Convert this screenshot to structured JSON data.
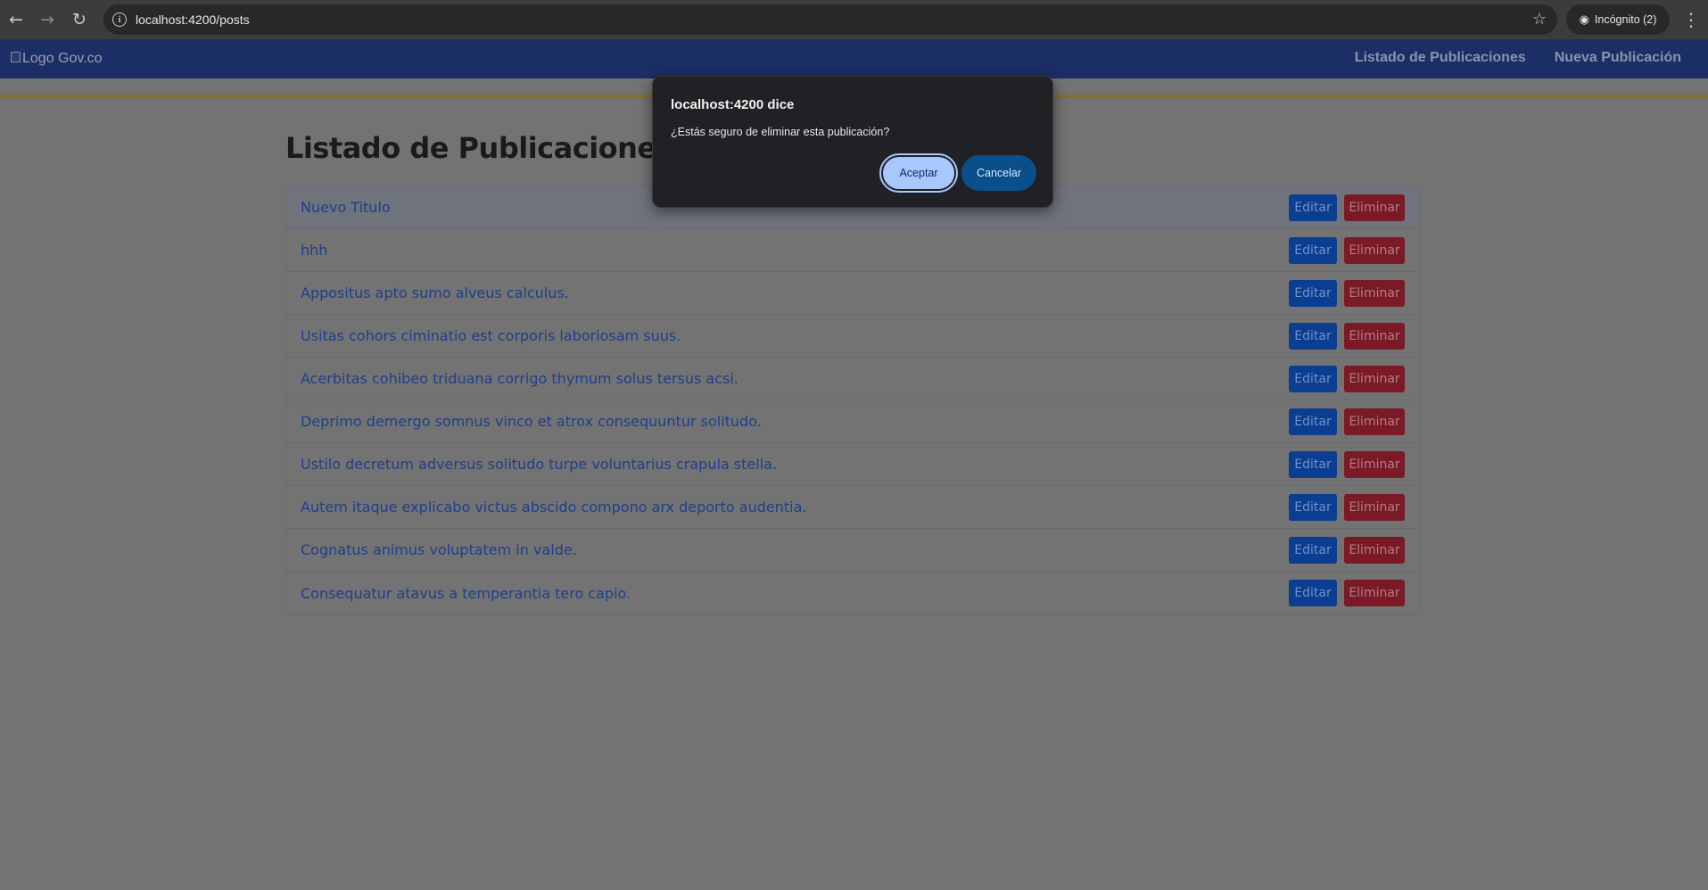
{
  "browser": {
    "url": "localhost:4200/posts",
    "incognito_label": "Incógnito (2)"
  },
  "navbar": {
    "logo_alt": "Logo Gov.co",
    "links": [
      {
        "label": "Listado de Publicaciones"
      },
      {
        "label": "Nueva Publicación"
      }
    ]
  },
  "main": {
    "title": "Listado de Publicaciones",
    "edit_label": "Editar",
    "delete_label": "Eliminar",
    "posts": [
      {
        "title": "Nuevo Titulo"
      },
      {
        "title": "hhh"
      },
      {
        "title": "Appositus apto sumo alveus calculus."
      },
      {
        "title": "Usitas cohors ciminatio est corporis laboriosam suus."
      },
      {
        "title": "Acerbitas cohibeo triduana corrigo thymum solus tersus acsi."
      },
      {
        "title": "Deprimo demergo somnus vinco et atrox consequuntur solitudo."
      },
      {
        "title": "Ustilo decretum adversus solitudo turpe voluntarius crapula stella."
      },
      {
        "title": "Autem itaque explicabo victus abscido compono arx deporto audentia."
      },
      {
        "title": "Cognatus animus voluptatem in valde."
      },
      {
        "title": "Consequatur atavus a temperantia tero capio."
      }
    ]
  },
  "dialog": {
    "title": "localhost:4200 dice",
    "message": "¿Estás seguro de eliminar esta publicación?",
    "accept_label": "Aceptar",
    "cancel_label": "Cancelar"
  },
  "colors": {
    "navbar_bg": "#1c2e66",
    "accent_line": "#8b6d2c",
    "edit_button": "#0b3d91",
    "delete_button": "#7a1a27",
    "dialog_accept": "#a8c7fa",
    "dialog_cancel": "#0a4f8a"
  }
}
